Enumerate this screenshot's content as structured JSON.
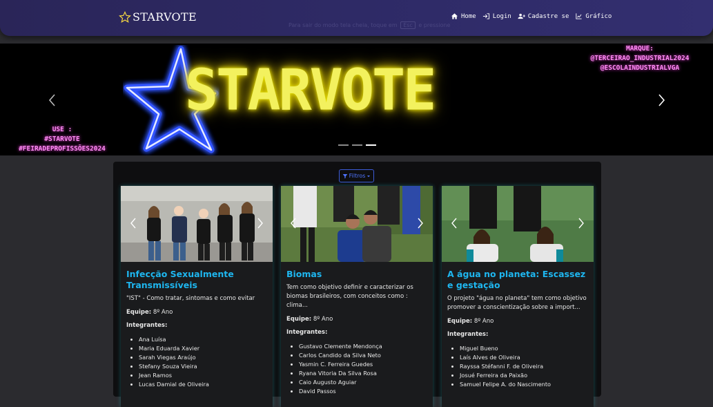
{
  "navbar": {
    "brand": "STARVOTE",
    "links": [
      {
        "label": "Home",
        "icon": "home-icon"
      },
      {
        "label": "Login",
        "icon": "login-icon"
      },
      {
        "label": "Cadastre se",
        "icon": "user-plus-icon"
      },
      {
        "label": "Gráfico",
        "icon": "chart-icon"
      }
    ],
    "esc_hint": {
      "before": "Para sair do modo tela cheia, toque em",
      "key": "Esc",
      "after": "e pressione"
    }
  },
  "carousel": {
    "headline": "STARVOTE",
    "left_text": [
      "USE :",
      "#STARVOTE",
      "#FEIRADEPROFISSÕES2024"
    ],
    "right_text": [
      "MARQUE:",
      "@TERCEIRAO_INDUSTRIAL2024",
      "@ESCOLAINDUSTRIALVGA"
    ],
    "slide_count": 3,
    "active_slide": 3,
    "colors": {
      "headline": "#f3f15e",
      "star": "#2f4bff",
      "tags": "#ff8cf5"
    }
  },
  "filter": {
    "label": "Filtros"
  },
  "cards": [
    {
      "title": "Infecção Sexualmente Transmissíveis",
      "description": "\"IST\" - Como tratar, sintomas e como evitar",
      "team_label": "Equipe:",
      "team": "8º Ano",
      "members_label": "Integrantes:",
      "members": [
        "Ana Luísa",
        "Maria Eduarda Xavier",
        "Sarah Viegas Araújo",
        "Stefany Souza Vieira",
        "Jean Ramos",
        "Lucas Damial de Oliveira"
      ]
    },
    {
      "title": "Biomas",
      "description": "Tem como objetivo definir e caracterizar os biomas brasileiros, com conceitos como : clima...",
      "team_label": "Equipe:",
      "team": "8º Ano",
      "members_label": "Integrantes:",
      "members": [
        "Gustavo Clemente Mendonça",
        "Carlos Candido da Silva Neto",
        "Yasmin C. Ferreira Guedes",
        "Ryana Vitoria Da Silva Rosa",
        "Caio Augusto Aguiar",
        "David Passos"
      ]
    },
    {
      "title": "A água no planeta: Escassez e gestação",
      "description": "O projeto \"água no planeta\" tem como objetivo promover a conscientização sobre a import...",
      "team_label": "Equipe:",
      "team": "8º Ano",
      "members_label": "Integrantes:",
      "members": [
        "Miguel Bueno",
        "Laís Alves de Oliveira",
        "Rayssa Stéfanni F. de Oliveira",
        "Josué Ferreira da Paixão",
        "Samuel Felipe A. do Nascimento"
      ]
    }
  ]
}
